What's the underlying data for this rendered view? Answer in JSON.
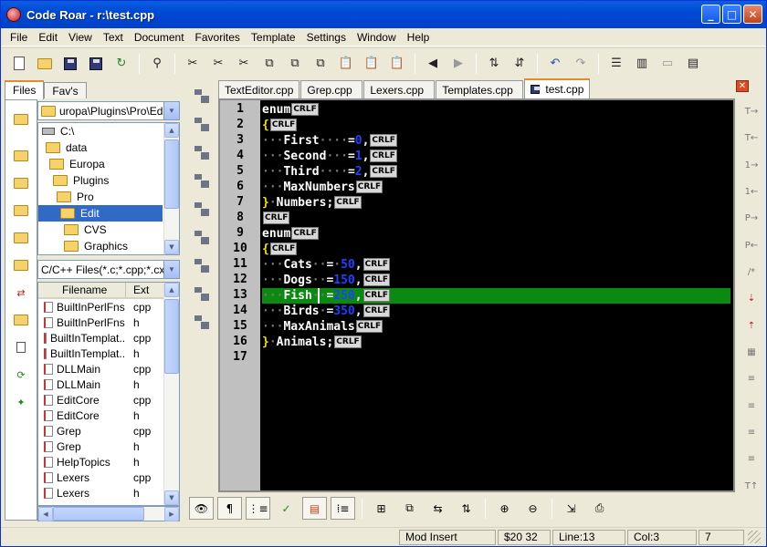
{
  "window": {
    "title": "Code Roar - r:\\test.cpp",
    "minimize": "_",
    "maximize": "□",
    "close": "✕"
  },
  "menu": [
    "File",
    "Edit",
    "View",
    "Text",
    "Document",
    "Favorites",
    "Template",
    "Settings",
    "Window",
    "Help"
  ],
  "left_tabs": [
    "Files",
    "Fav's"
  ],
  "path": "uropa\\Plugins\\Pro\\Edit",
  "tree": [
    {
      "label": "C:\\",
      "level": 0,
      "icon": "drive-icon"
    },
    {
      "label": "data",
      "level": 1,
      "icon": "folder-icon"
    },
    {
      "label": "Europa",
      "level": 2,
      "icon": "folder-icon"
    },
    {
      "label": "Plugins",
      "level": 3,
      "icon": "folder-icon"
    },
    {
      "label": "Pro",
      "level": 4,
      "icon": "folder-icon"
    },
    {
      "label": "Edit",
      "level": 5,
      "icon": "folder-open-icon",
      "selected": true
    },
    {
      "label": "CVS",
      "level": 6,
      "icon": "folder-icon"
    },
    {
      "label": "Graphics",
      "level": 6,
      "icon": "folder-icon"
    }
  ],
  "filter": "C/C++ Files(*.c;*.cpp;*.cxx;*",
  "file_columns": {
    "name": "Filename",
    "ext": "Ext"
  },
  "files": [
    {
      "name": "BuiltInPerlFns",
      "ext": "cpp"
    },
    {
      "name": "BuiltInPerlFns",
      "ext": "h"
    },
    {
      "name": "BuiltInTemplat...",
      "ext": "cpp"
    },
    {
      "name": "BuiltInTemplat...",
      "ext": "h"
    },
    {
      "name": "DLLMain",
      "ext": "cpp"
    },
    {
      "name": "DLLMain",
      "ext": "h"
    },
    {
      "name": "EditCore",
      "ext": "cpp"
    },
    {
      "name": "EditCore",
      "ext": "h"
    },
    {
      "name": "Grep",
      "ext": "cpp"
    },
    {
      "name": "Grep",
      "ext": "h"
    },
    {
      "name": "HelpTopics",
      "ext": "h"
    },
    {
      "name": "Lexers",
      "ext": "cpp"
    },
    {
      "name": "Lexers",
      "ext": "h"
    }
  ],
  "editor_tabs": [
    {
      "label": "TextEditor.cpp"
    },
    {
      "label": "Grep.cpp"
    },
    {
      "label": "Lexers.cpp"
    },
    {
      "label": "Templates.cpp"
    },
    {
      "label": "test.cpp",
      "active": true
    }
  ],
  "code": {
    "line_numbers": [
      "1",
      "2",
      "3",
      "4",
      "5",
      "6",
      "7",
      "8",
      "9",
      "10",
      "11",
      "12",
      "13",
      "14",
      "15",
      "16",
      "17"
    ],
    "eol_marker": "CRLF",
    "current_line": 13,
    "lines": [
      [
        {
          "t": "enum"
        },
        {
          "crlf": true
        }
      ],
      [
        {
          "t": "{",
          "c": "#f0e000"
        },
        {
          "crlf": true
        }
      ],
      [
        {
          "t": "···",
          "c": "#777"
        },
        {
          "t": "First"
        },
        {
          "t": "····",
          "c": "#777"
        },
        {
          "t": "="
        },
        {
          "t": "0",
          "c": "#2040ff"
        },
        {
          "t": ","
        },
        {
          "crlf": true
        }
      ],
      [
        {
          "t": "···",
          "c": "#777"
        },
        {
          "t": "Second"
        },
        {
          "t": "···",
          "c": "#777"
        },
        {
          "t": "="
        },
        {
          "t": "1",
          "c": "#2040ff"
        },
        {
          "t": ","
        },
        {
          "crlf": true
        }
      ],
      [
        {
          "t": "···",
          "c": "#777"
        },
        {
          "t": "Third"
        },
        {
          "t": "····",
          "c": "#777"
        },
        {
          "t": "="
        },
        {
          "t": "2",
          "c": "#2040ff"
        },
        {
          "t": ","
        },
        {
          "crlf": true
        }
      ],
      [
        {
          "t": "···",
          "c": "#777"
        },
        {
          "t": "MaxNumbers"
        },
        {
          "crlf": true
        }
      ],
      [
        {
          "t": "}",
          "c": "#f0e000"
        },
        {
          "t": "·",
          "c": "#777"
        },
        {
          "t": "Numbers;"
        },
        {
          "crlf": true
        }
      ],
      [
        {
          "crlf": true
        }
      ],
      [
        {
          "t": "enum"
        },
        {
          "crlf": true
        }
      ],
      [
        {
          "t": "{",
          "c": "#f0e000"
        },
        {
          "crlf": true
        }
      ],
      [
        {
          "t": "···",
          "c": "#777"
        },
        {
          "t": "Cats"
        },
        {
          "t": "··",
          "c": "#777"
        },
        {
          "t": "="
        },
        {
          "t": "·",
          "c": "#777"
        },
        {
          "t": "50",
          "c": "#2040ff"
        },
        {
          "t": ","
        },
        {
          "crlf": true
        }
      ],
      [
        {
          "t": "···",
          "c": "#777"
        },
        {
          "t": "Dogs"
        },
        {
          "t": "··",
          "c": "#777"
        },
        {
          "t": "="
        },
        {
          "t": "150",
          "c": "#2040ff"
        },
        {
          "t": ","
        },
        {
          "crlf": true
        }
      ],
      [
        {
          "t": "···",
          "c": "#777"
        },
        {
          "t": "Fish"
        },
        {
          "t": "··",
          "c": "#777"
        },
        {
          "t": "="
        },
        {
          "t": "250",
          "c": "#2040ff"
        },
        {
          "t": ","
        },
        {
          "crlf": true
        }
      ],
      [
        {
          "t": "···",
          "c": "#777"
        },
        {
          "t": "Birds"
        },
        {
          "t": "·",
          "c": "#777"
        },
        {
          "t": "="
        },
        {
          "t": "350",
          "c": "#2040ff"
        },
        {
          "t": ","
        },
        {
          "crlf": true
        }
      ],
      [
        {
          "t": "···",
          "c": "#777"
        },
        {
          "t": "MaxAnimals"
        },
        {
          "crlf": true
        }
      ],
      [
        {
          "t": "}",
          "c": "#f0e000"
        },
        {
          "t": "·",
          "c": "#777"
        },
        {
          "t": "Animals;"
        },
        {
          "crlf": true
        }
      ],
      []
    ]
  },
  "status": {
    "mode": "Mod Insert",
    "char": "$20  32",
    "line": "Line:13",
    "col": "Col:3",
    "extra": "7"
  },
  "colors": {
    "highlight": "#0a8a10",
    "number": "#2040ff",
    "brace": "#f0e000",
    "gutter": "#c0c0c0"
  }
}
